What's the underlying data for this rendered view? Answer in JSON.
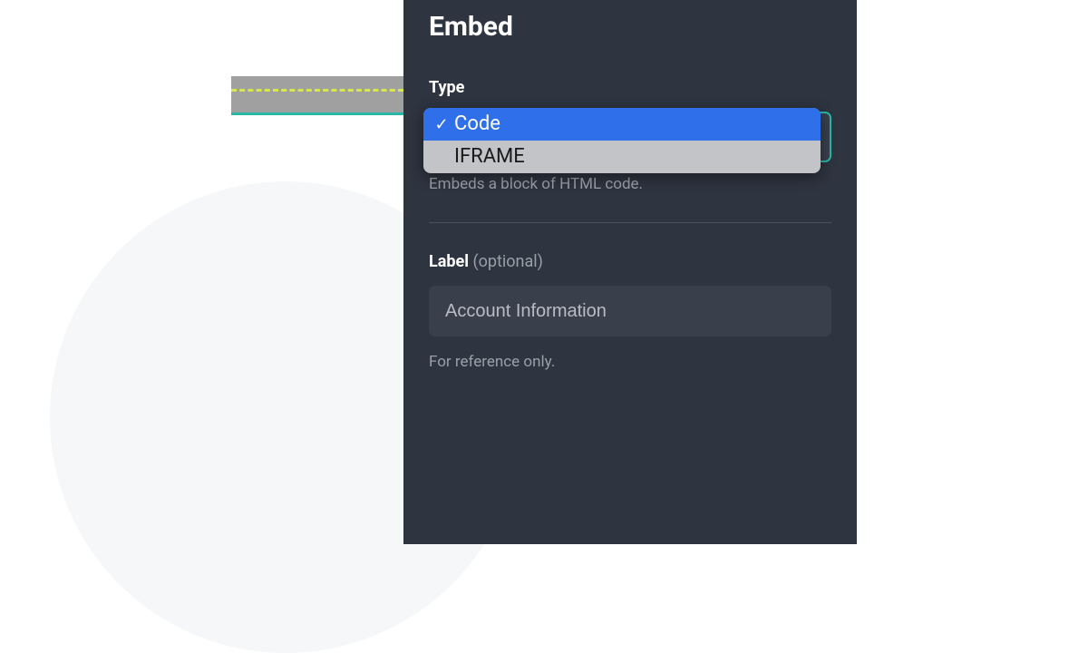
{
  "panel": {
    "title": "Embed",
    "type": {
      "label": "Type",
      "options": [
        {
          "label": "Code",
          "selected": true
        },
        {
          "label": "IFRAME",
          "selected": false
        }
      ],
      "help": "Embeds a block of HTML code."
    },
    "label_field": {
      "label": "Label",
      "optional": "(optional)",
      "value": "Account Information",
      "help": "For reference only."
    }
  }
}
